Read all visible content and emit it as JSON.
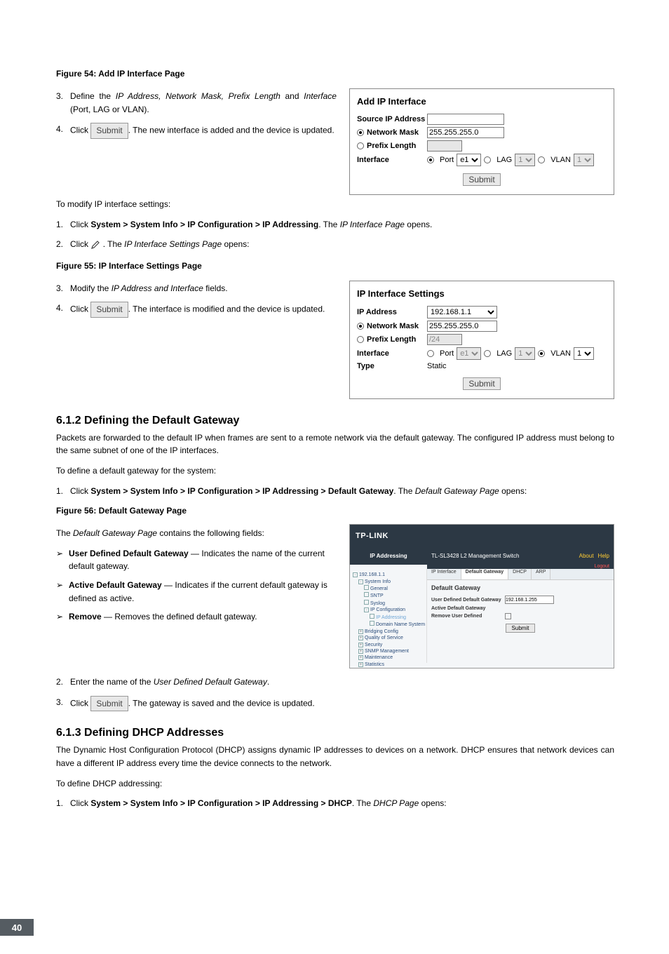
{
  "page_number": "40",
  "fig54": {
    "caption": "Figure 54: Add IP Interface Page",
    "panel_title": "Add IP Interface",
    "source_ip_label": "Source IP Address",
    "network_mask_label": "Network Mask",
    "network_mask_value": "255.255.255.0",
    "prefix_length_label": "Prefix Length",
    "interface_label": "Interface",
    "port_label": "Port",
    "port_value": "e1",
    "lag_label": "LAG",
    "lag_value": "1",
    "vlan_label": "VLAN",
    "vlan_value": "1",
    "submit": "Submit"
  },
  "steps_fig54": {
    "s3_a": "Define the ",
    "s3_b": "IP Address, Network Mask, Prefix Length",
    "s3_c": " and ",
    "s3_d": "Interface",
    "s3_e": " (Port, LAG or VLAN).",
    "s4_a": "Click ",
    "s4_btn": "Submit",
    "s4_b": ". The new interface is added and the device is updated."
  },
  "modify_intro": "To modify IP interface settings:",
  "modify_steps": {
    "s1_a": "Click ",
    "s1_b": "System > System Info > IP Configuration > IP Addressing",
    "s1_c": ". The ",
    "s1_d": "IP Interface Page",
    "s1_e": " opens.",
    "s2_a": "Click ",
    "s2_b": " . The ",
    "s2_c": "IP Interface Settings Page",
    "s2_d": " opens:"
  },
  "fig55": {
    "caption": "Figure 55: IP Interface Settings Page",
    "panel_title": "IP Interface Settings",
    "ip_label": "IP Address",
    "ip_value": "192.168.1.1",
    "network_mask_label": "Network Mask",
    "network_mask_value": "255.255.255.0",
    "prefix_length_label": "Prefix Length",
    "prefix_length_value": "/24",
    "interface_label": "Interface",
    "port_label": "Port",
    "port_value": "e1",
    "lag_label": "LAG",
    "lag_value": "1",
    "vlan_label": "VLAN",
    "vlan_value": "1",
    "type_label": "Type",
    "type_value": "Static",
    "submit": "Submit"
  },
  "steps_fig55": {
    "s3_a": "Modify the ",
    "s3_b": "IP Address and Interface",
    "s3_c": " fields.",
    "s4_a": "Click ",
    "s4_btn": "Submit",
    "s4_b": ". The interface is modified and the device is updated."
  },
  "sec612": {
    "heading": "6.1.2   Defining the Default Gateway",
    "para": "Packets are forwarded to the default IP when frames are sent to a remote network via the default gateway. The configured IP address must belong to the same subnet of one of the IP interfaces.",
    "intro": "To define a default gateway for the system:",
    "s1_a": "Click ",
    "s1_b": "System > System Info > IP Configuration > IP Addressing > Default Gateway",
    "s1_c": ". The ",
    "s1_d": "Default Gateway Page",
    "s1_e": " opens:"
  },
  "fig56": {
    "caption": "Figure 56: Default Gateway Page",
    "logo": "TP-LINK",
    "breadcrumb": "IP Addressing",
    "top_title": "TL-SL3428 L2 Management Switch",
    "about": "About",
    "help": "Help",
    "logout": "Logout",
    "tabs": [
      "IP Interface",
      "Default Gateway",
      "DHCP",
      "ARP"
    ],
    "tree": {
      "root": "192.168.1.1",
      "system_info": "System Info",
      "general": "General",
      "sntp": "SNTP",
      "syslog": "Syslog",
      "ipconf": "IP Configuration",
      "ipaddr": "IP Addressing",
      "dns": "Domain Name System",
      "bridging": "Bridging Config",
      "qos": "Quality of Service",
      "security": "Security",
      "snmp": "SNMP Management",
      "maint": "Maintenance",
      "stats": "Statistics"
    },
    "main": {
      "title": "Default Gateway",
      "udg_label": "User Defined Default Gateway",
      "udg_value": "192.168.1.255",
      "adg_label": "Active Default Gateway",
      "remove_label": "Remove User Defined",
      "submit": "Submit"
    }
  },
  "fig56_text": {
    "intro": "The ",
    "intro_i": "Default Gateway Page",
    "intro_b": " contains the following fields:",
    "b1_a": "User Defined Default Gateway",
    "b1_b": " — Indicates the name of the current default gateway.",
    "b2_a": "Active Default Gateway",
    "b2_b": " — Indicates if the current default gateway is defined as active.",
    "b3_a": "Remove",
    "b3_b": " — Removes the defined default gateway.",
    "s2_a": "Enter the name of the ",
    "s2_b": "User Defined Default Gateway",
    "s2_c": ".",
    "s3_a": "Click ",
    "s3_btn": "Submit",
    "s3_b": ". The gateway is saved and the device is updated."
  },
  "sec613": {
    "heading": "6.1.3   Defining DHCP Addresses",
    "para": "The Dynamic Host Configuration Protocol (DHCP) assigns dynamic IP addresses to devices on a network. DHCP ensures that network devices can have a different IP address every time the device connects to the network.",
    "intro": "To define DHCP addressing:",
    "s1_a": "Click ",
    "s1_b": "System > System Info > IP Configuration > IP Addressing > DHCP",
    "s1_c": ". The ",
    "s1_d": "DHCP Page",
    "s1_e": " opens:"
  }
}
